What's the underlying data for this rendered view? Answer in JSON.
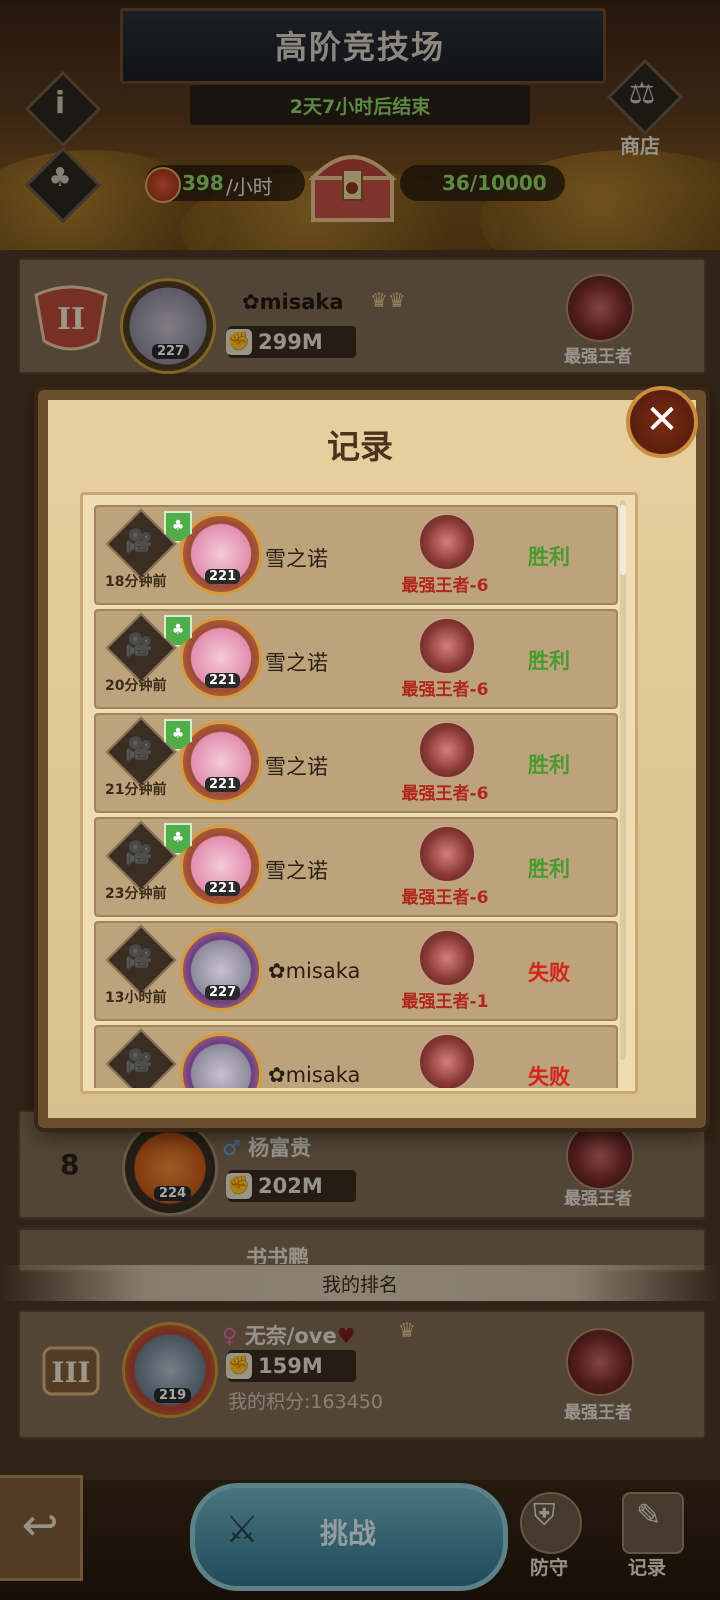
{
  "header": {
    "title": "高阶竞技场",
    "timer": "2天7小时后结束",
    "info_icon": "i",
    "shop_label": "商店",
    "rate_value": "398",
    "rate_unit": "/小时",
    "chest_progress": "36/10000"
  },
  "top_row": {
    "player_name": "misaka",
    "level": "227",
    "power": "299M",
    "rank_title": "最强王者"
  },
  "row_8": {
    "rank": "8",
    "player_name": "杨富贵",
    "level": "224",
    "power": "202M",
    "rank_title": "最强王者"
  },
  "row_9": {
    "player_name": "书书鹏"
  },
  "modal": {
    "title": "记录",
    "close_label": "✕",
    "records": [
      {
        "time": "18分钟前",
        "name": "雪之诺",
        "level": "221",
        "rank": "最强王者-6",
        "result": "胜利",
        "win": true
      },
      {
        "time": "20分钟前",
        "name": "雪之诺",
        "level": "221",
        "rank": "最强王者-6",
        "result": "胜利",
        "win": true
      },
      {
        "time": "21分钟前",
        "name": "雪之诺",
        "level": "221",
        "rank": "最强王者-6",
        "result": "胜利",
        "win": true
      },
      {
        "time": "23分钟前",
        "name": "雪之诺",
        "level": "221",
        "rank": "最强王者-6",
        "result": "胜利",
        "win": true
      },
      {
        "time": "13小时前",
        "name": "misaka",
        "level": "227",
        "rank": "最强王者-1",
        "result": "失败",
        "win": false
      },
      {
        "time": "",
        "name": "misaka",
        "level": "",
        "rank": "",
        "result": "失败",
        "win": false
      }
    ]
  },
  "my_rank": {
    "header": "我的排名",
    "player_name": "无奈/ove",
    "level": "219",
    "power": "159M",
    "score": "我的积分:163450",
    "rank_title": "最强王者"
  },
  "bottom_bar": {
    "challenge_label": "挑战",
    "defense_label": "防守",
    "records_label": "记录"
  }
}
